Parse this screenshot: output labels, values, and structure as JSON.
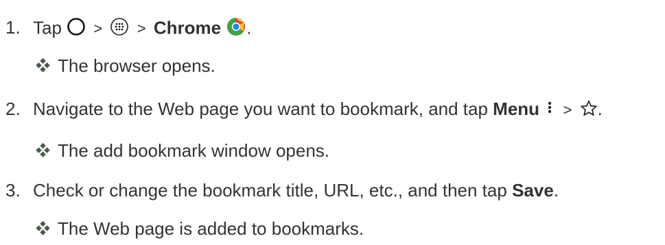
{
  "steps": [
    {
      "number": "1.",
      "parts": {
        "tap": "Tap",
        "gt1": ">",
        "gt2": ">",
        "chrome": "Chrome",
        "period": "."
      },
      "icons": [
        "home-circle-icon",
        "apps-icon",
        "chrome-icon"
      ],
      "result": "The browser opens."
    },
    {
      "number": "2.",
      "parts": {
        "text": "Navigate to the Web page you want to bookmark, and tap ",
        "menu": "Menu",
        "gt": ">",
        "period": "."
      },
      "icons": [
        "menu-dots-icon",
        "star-icon"
      ],
      "result": "The add bookmark window opens."
    },
    {
      "number": "3.",
      "parts": {
        "text": "Check or change the bookmark title, URL, etc., and then tap ",
        "save": "Save",
        "period": "."
      },
      "result": "The Web page is added to bookmarks."
    }
  ],
  "colors": {
    "text": "#333333",
    "bullet": "#4a5a4a"
  }
}
